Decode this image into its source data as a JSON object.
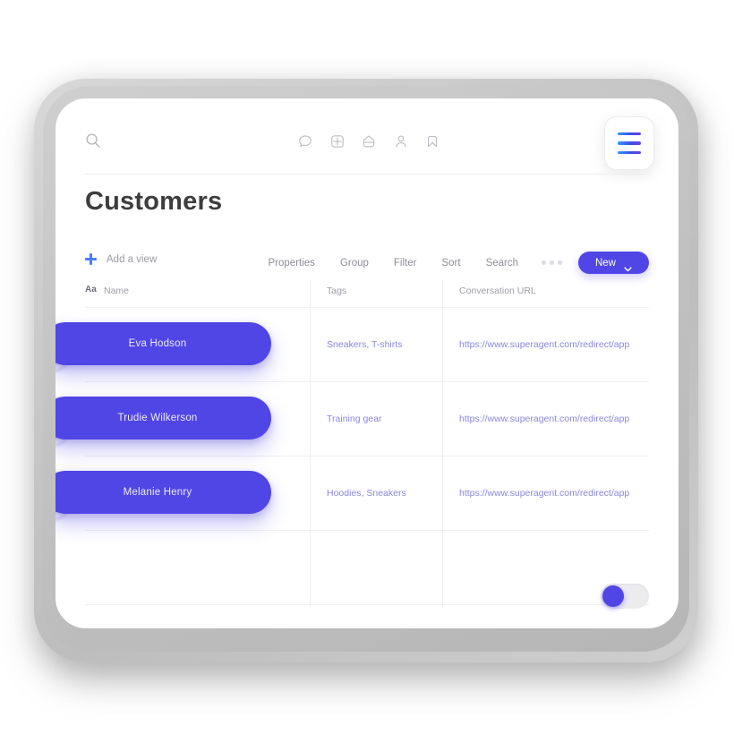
{
  "nav": {
    "search_icon": "search-icon",
    "center_icons": [
      {
        "name": "chat-bubble-icon"
      },
      {
        "name": "grid-plus-icon"
      },
      {
        "name": "home-icon"
      },
      {
        "name": "user-icon"
      },
      {
        "name": "bookmark-icon"
      }
    ],
    "menu_icon": "hamburger-menu-icon"
  },
  "page": {
    "title": "Customers"
  },
  "toolbar": {
    "add_view_label": "Add a view",
    "actions": [
      "Properties",
      "Group",
      "Filter",
      "Sort",
      "Search"
    ],
    "more_icon": "more-horizontal-icon",
    "new_label": "New",
    "new_chevron_icon": "chevron-down-icon"
  },
  "table": {
    "columns": [
      {
        "key": "name",
        "label": "Name",
        "type_badge": "Aa"
      },
      {
        "key": "tags",
        "label": "Tags"
      },
      {
        "key": "url",
        "label": "Conversation URL"
      }
    ],
    "rows": [
      {
        "name": "Eva Hodson",
        "tags": "Sneakers, T-shirts",
        "url": "https://www.superagent.com/redirect/app"
      },
      {
        "name": "Trudie Wilkerson",
        "tags": "Training gear",
        "url": "https://www.superagent.com/redirect/app"
      },
      {
        "name": "Melanie Henry",
        "tags": "Hoodies, Sneakers",
        "url": "https://www.superagent.com/redirect/app"
      }
    ]
  },
  "toggle": {
    "name": "view-toggle",
    "state": "off"
  },
  "colors": {
    "accent": "#5046e5",
    "link": "#8a86e0",
    "muted_text": "#9a9aa2",
    "title": "#3d3d3d",
    "grid_line": "#efeff2",
    "bezel": "#c2c2c2"
  }
}
